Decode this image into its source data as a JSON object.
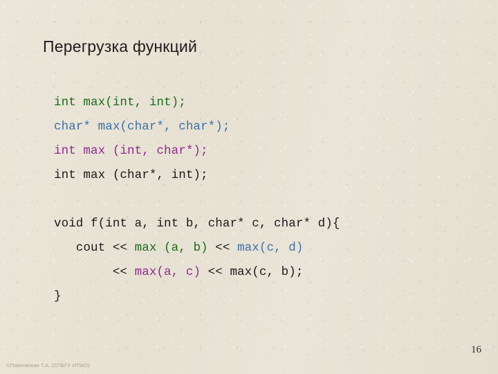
{
  "slide": {
    "title": "Перегрузка функций",
    "page_number": "16",
    "footer_credit": "©Павловская Т.А. (СПБГУ ИТМО)",
    "background_color": "#e9e3d6"
  },
  "palette": {
    "green": "#1a6b1a",
    "blue": "#3f6fa8",
    "purple": "#8e2a8e",
    "black": "#1a1a1a",
    "title": "#1d1d1d",
    "footer": "#a9a091"
  },
  "code": {
    "lines": [
      {
        "id": "decl-int-int",
        "tokens": [
          {
            "text": "int max(int, int);",
            "color": "green"
          }
        ]
      },
      {
        "id": "decl-char-char",
        "tokens": [
          {
            "text": "char* max(char*, char*);",
            "color": "blue"
          }
        ]
      },
      {
        "id": "decl-int-char",
        "tokens": [
          {
            "text": "int max (int, char*);",
            "color": "purple"
          }
        ]
      },
      {
        "id": "decl-char-int",
        "tokens": [
          {
            "text": "int max (char*, int);",
            "color": "black"
          }
        ]
      },
      {
        "id": "blank",
        "tokens": []
      },
      {
        "id": "func-signature",
        "tokens": [
          {
            "text": "void f(int a, int b, char* c, char* d){",
            "color": "black"
          }
        ]
      },
      {
        "id": "cout-line-1",
        "tokens": [
          {
            "text": "   cout << ",
            "color": "black"
          },
          {
            "text": "max (a, b)",
            "color": "green"
          },
          {
            "text": " << ",
            "color": "black"
          },
          {
            "text": "max(c, d)",
            "color": "blue"
          }
        ]
      },
      {
        "id": "cout-line-2",
        "tokens": [
          {
            "text": "        << ",
            "color": "black"
          },
          {
            "text": "max(a, c)",
            "color": "purple"
          },
          {
            "text": " << max(c, b);",
            "color": "black"
          }
        ]
      },
      {
        "id": "func-close",
        "tokens": [
          {
            "text": "}",
            "color": "black"
          }
        ]
      }
    ]
  }
}
